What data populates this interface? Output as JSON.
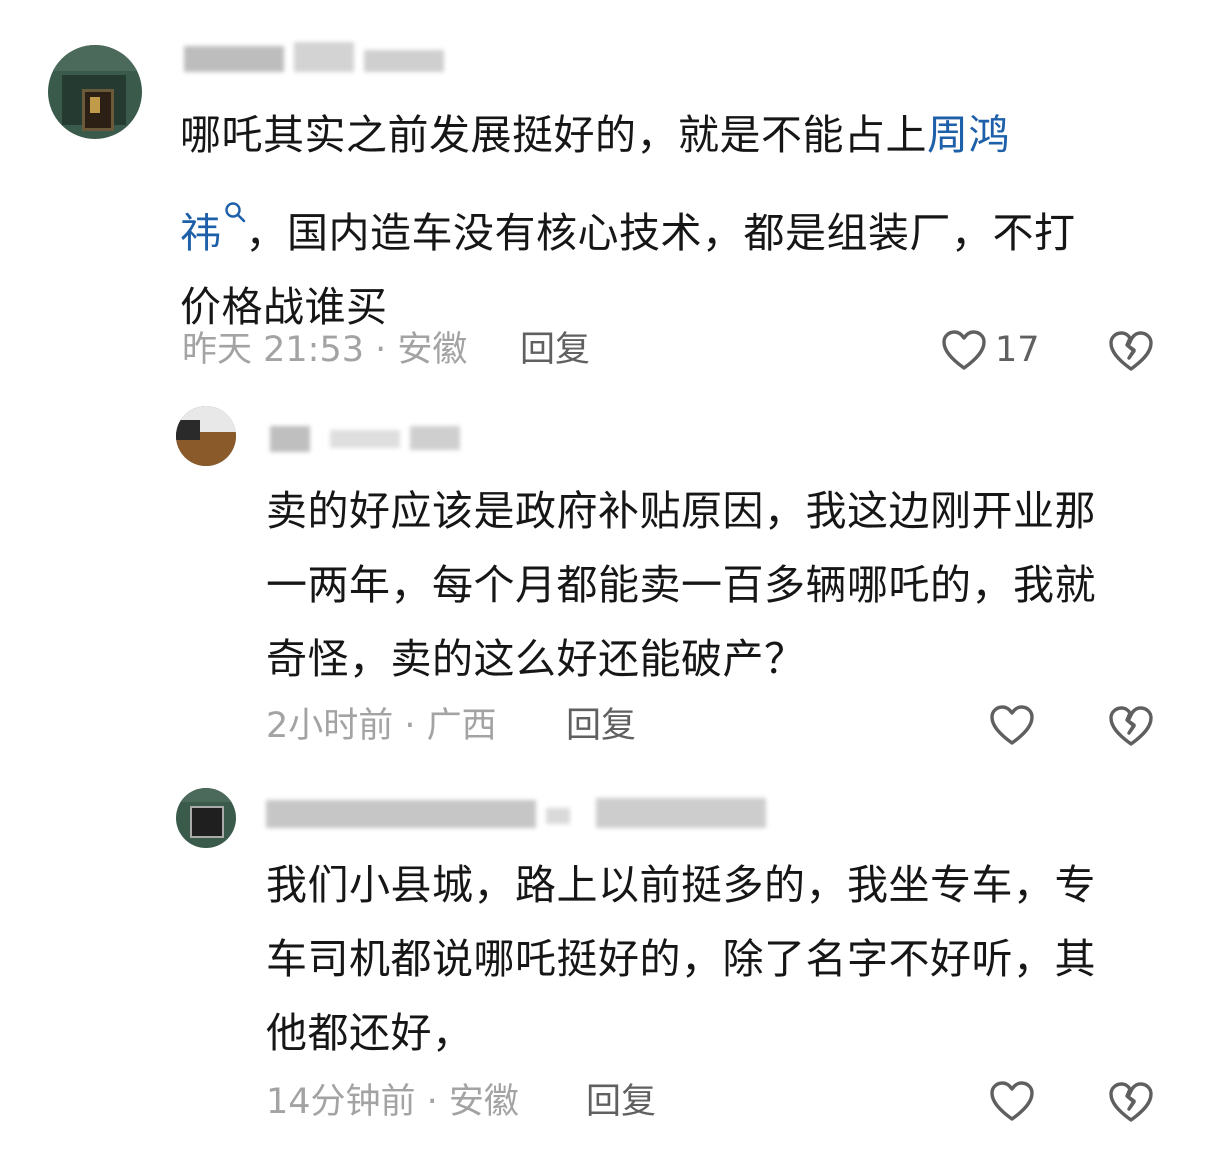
{
  "comments": [
    {
      "user": "",
      "mention_text": "哪吒其实之前发展挺好的，就是不能占上",
      "mention": "周鸿",
      "mention_tail": "祎",
      "line2": "，国内造车没有核心技术，都是组装厂，不打",
      "line3": "价格战谁买",
      "meta": "昨天 21:53 · 安徽",
      "reply": "回复",
      "likes": "17"
    },
    {
      "user": "",
      "lines": [
        "卖的好应该是政府补贴原因，我这边刚开业那",
        "一两年，每个月都能卖一百多辆哪吒的，我就",
        "奇怪，卖的这么好还能破产？"
      ],
      "meta": "2小时前 · 广西",
      "reply": "回复",
      "likes": ""
    },
    {
      "user": "",
      "lines": [
        "我们小县城，路上以前挺多的，我坐专车，专",
        "车司机都说哪吒挺好的，除了名字不好听，其",
        "他都还好，"
      ],
      "meta": "14分钟前 · 安徽",
      "reply": "回复",
      "likes": ""
    }
  ],
  "icons": {
    "like": "heart-outline-icon",
    "dislike": "broken-heart-icon",
    "search": "search-icon"
  },
  "colors": {
    "mention": "#1d5fa8",
    "meta": "#a3a3a3",
    "reply": "#606060"
  }
}
